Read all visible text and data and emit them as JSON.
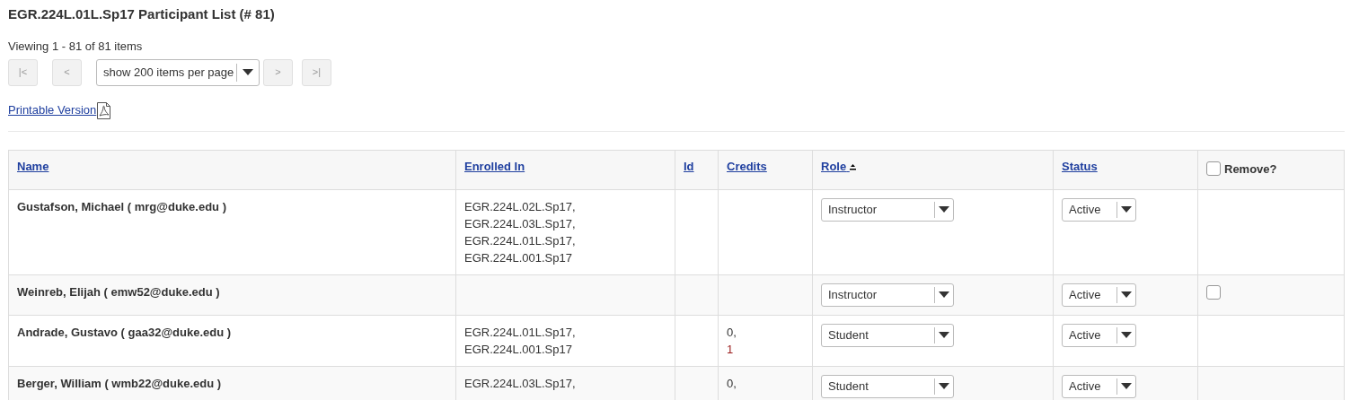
{
  "title": "EGR.224L.01L.Sp17 Participant List (# 81)",
  "viewing": "Viewing 1 - 81 of 81 items",
  "pager": {
    "first": "|<",
    "prev": "<",
    "page_size": "show 200 items per page",
    "next": ">",
    "last": ">|"
  },
  "printable_link": "Printable Version",
  "table": {
    "columns": [
      {
        "label": "Name",
        "sorted": false
      },
      {
        "label": "Enrolled In",
        "sorted": false
      },
      {
        "label": "Id",
        "sorted": false
      },
      {
        "label": "Credits",
        "sorted": false
      },
      {
        "label": "Role",
        "sorted": true
      },
      {
        "label": "Status",
        "sorted": false
      }
    ],
    "remove_header": {
      "label": "Remove?",
      "checked": false
    },
    "rows": [
      {
        "name": "Gustafson, Michael ( mrg@duke.edu )",
        "enrolled_in": [
          "EGR.224L.02L.Sp17,",
          "EGR.224L.03L.Sp17,",
          "EGR.224L.01L.Sp17,",
          "EGR.224L.001.Sp17"
        ],
        "credits": [],
        "role": "Instructor",
        "status": "Active"
      },
      {
        "name": "Weinreb, Elijah ( emw52@duke.edu )",
        "enrolled_in": [],
        "credits": [],
        "role": "Instructor",
        "status": "Active",
        "remove": {
          "checked": false
        }
      },
      {
        "name": "Andrade, Gustavo ( gaa32@duke.edu )",
        "enrolled_in": [
          "EGR.224L.01L.Sp17,",
          "EGR.224L.001.Sp17"
        ],
        "credits": [
          {
            "text": "0,",
            "highlighted": false
          },
          {
            "text": "1",
            "highlighted": true
          }
        ],
        "role": "Student",
        "status": "Active"
      },
      {
        "name": "Berger, William ( wmb22@duke.edu )",
        "enrolled_in": [
          "EGR.224L.03L.Sp17,"
        ],
        "credits": [
          {
            "text": "0,",
            "highlighted": false
          }
        ],
        "role": "Student",
        "status": "Active"
      }
    ]
  }
}
